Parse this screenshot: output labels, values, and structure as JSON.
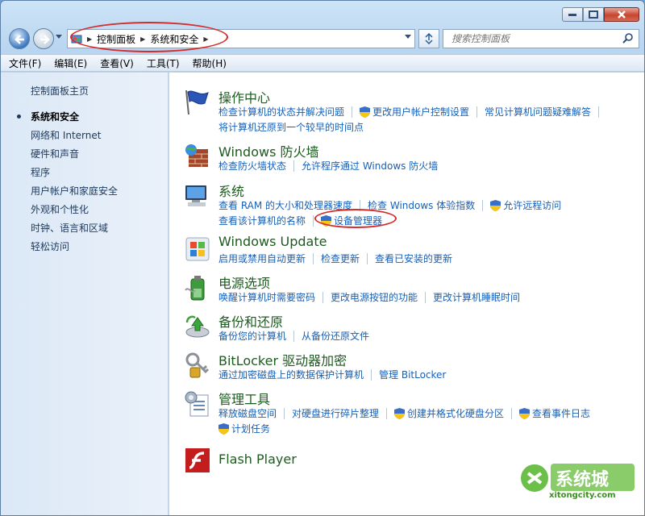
{
  "window": {
    "address": {
      "crumbs": [
        "控制面板",
        "系统和安全"
      ]
    },
    "search_placeholder": "搜索控制面板"
  },
  "menu": [
    "文件(F)",
    "编辑(E)",
    "查看(V)",
    "工具(T)",
    "帮助(H)"
  ],
  "sidebar": {
    "home": "控制面板主页",
    "items": [
      "系统和安全",
      "网络和 Internet",
      "硬件和声音",
      "程序",
      "用户帐户和家庭安全",
      "外观和个性化",
      "时钟、语言和区域",
      "轻松访问"
    ],
    "active_index": 0
  },
  "categories": [
    {
      "title": "操作中心",
      "icon": "flag-icon",
      "rows": [
        [
          {
            "t": "检查计算机的状态并解决问题"
          },
          {
            "t": "更改用户帐户控制设置",
            "shield": true
          },
          {
            "t": "常见计算机问题疑难解答"
          }
        ],
        [
          {
            "t": "将计算机还原到一个较早的时间点"
          }
        ]
      ]
    },
    {
      "title": "Windows 防火墙",
      "icon": "firewall-icon",
      "rows": [
        [
          {
            "t": "检查防火墙状态"
          },
          {
            "t": "允许程序通过 Windows 防火墙"
          }
        ]
      ]
    },
    {
      "title": "系统",
      "icon": "computer-icon",
      "rows": [
        [
          {
            "t": "查看 RAM 的大小和处理器速度"
          },
          {
            "t": "检查 Windows 体验指数"
          },
          {
            "t": "允许远程访问",
            "shield": true
          }
        ],
        [
          {
            "t": "查看该计算机的名称"
          },
          {
            "t": "设备管理器",
            "shield": true
          }
        ]
      ]
    },
    {
      "title": "Windows Update",
      "icon": "windows-update-icon",
      "rows": [
        [
          {
            "t": "启用或禁用自动更新"
          },
          {
            "t": "检查更新"
          },
          {
            "t": "查看已安装的更新"
          }
        ]
      ]
    },
    {
      "title": "电源选项",
      "icon": "battery-icon",
      "rows": [
        [
          {
            "t": "唤醒计算机时需要密码"
          },
          {
            "t": "更改电源按钮的功能"
          },
          {
            "t": "更改计算机睡眠时间"
          }
        ]
      ]
    },
    {
      "title": "备份和还原",
      "icon": "backup-icon",
      "rows": [
        [
          {
            "t": "备份您的计算机"
          },
          {
            "t": "从备份还原文件"
          }
        ]
      ]
    },
    {
      "title": "BitLocker 驱动器加密",
      "icon": "keys-icon",
      "rows": [
        [
          {
            "t": "通过加密磁盘上的数据保护计算机"
          },
          {
            "t": "管理 BitLocker"
          }
        ]
      ]
    },
    {
      "title": "管理工具",
      "icon": "admin-tools-icon",
      "rows": [
        [
          {
            "t": "释放磁盘空间"
          },
          {
            "t": "对硬盘进行碎片整理"
          },
          {
            "t": "创建并格式化硬盘分区",
            "shield": true
          },
          {
            "t": "查看事件日志",
            "shield": true
          }
        ],
        [
          {
            "t": "计划任务",
            "shield": true
          }
        ]
      ]
    },
    {
      "title": "Flash Player",
      "icon": "flash-icon",
      "rows": []
    }
  ],
  "watermark": {
    "brand": "系统城",
    "domain": "xitongcity.com"
  },
  "colors": {
    "link": "#1660b8",
    "title": "#1e5a20",
    "highlight": "#d62b2b"
  }
}
